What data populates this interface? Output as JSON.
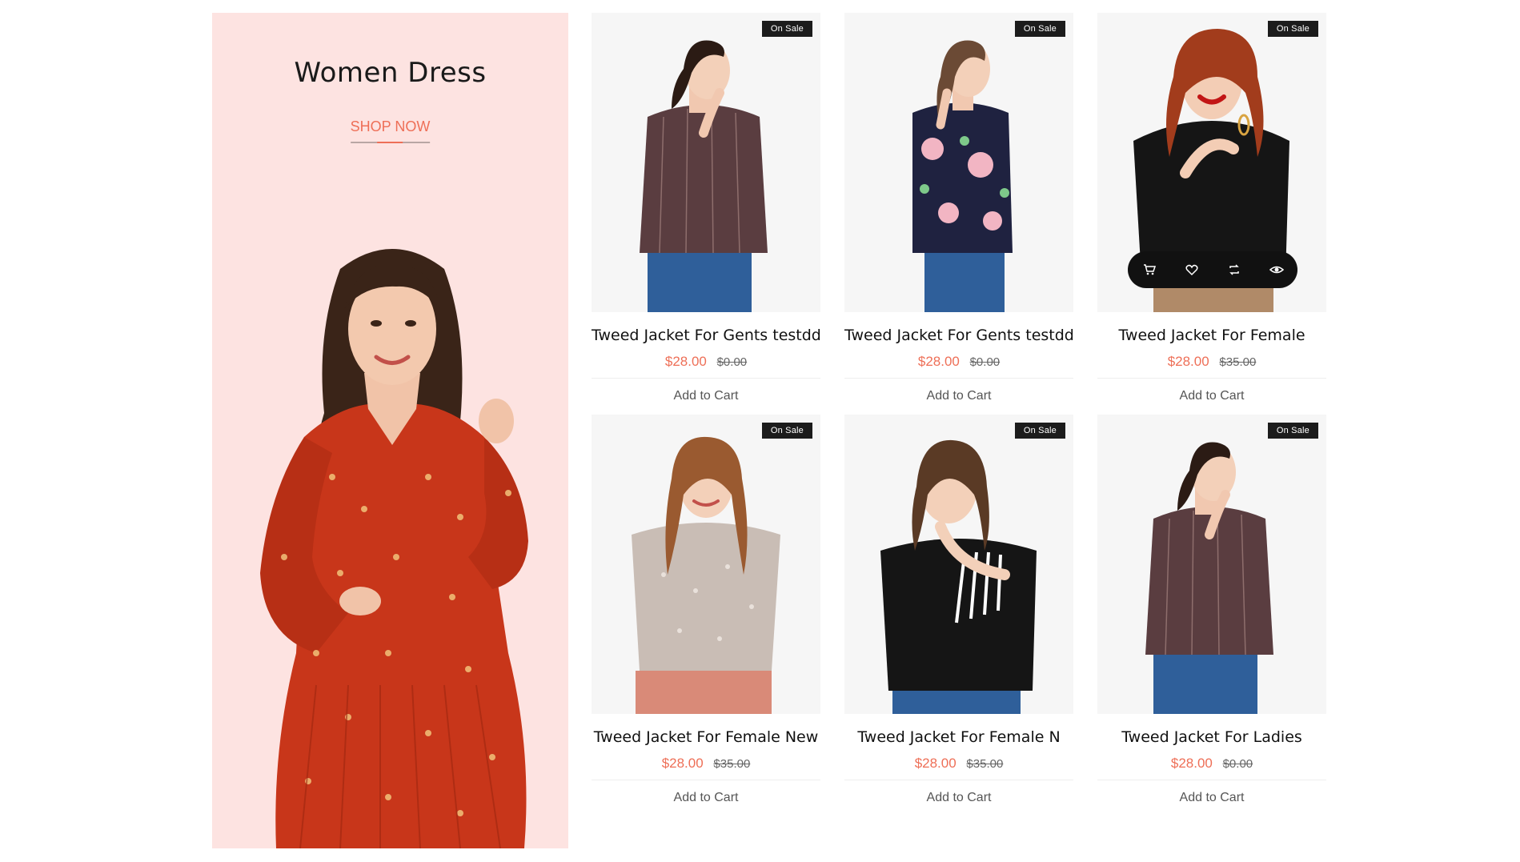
{
  "banner": {
    "title": "Women Dress",
    "cta_label": "SHOP NOW",
    "background_color": "#fde3e1",
    "accent_color": "#ee6f57"
  },
  "products": [
    {
      "title": "Tweed Jacket For Gents testdd",
      "price": "$28.00",
      "old_price": "$0.00",
      "badge": "On Sale",
      "cart_label": "Add to Cart",
      "image": "woman-striped-shirt"
    },
    {
      "title": "Tweed Jacket For Gents testdd",
      "price": "$28.00",
      "old_price": "$0.00",
      "badge": "On Sale",
      "cart_label": "Add to Cart",
      "image": "woman-floral-blouse"
    },
    {
      "title": "Tweed Jacket For Female",
      "price": "$28.00",
      "old_price": "$35.00",
      "badge": "On Sale",
      "cart_label": "Add to Cart",
      "image": "woman-black-sweater-red-hair"
    },
    {
      "title": "Tweed Jacket For Female New",
      "price": "$28.00",
      "old_price": "$35.00",
      "badge": "On Sale",
      "cart_label": "Add to Cart",
      "image": "woman-sequin-top"
    },
    {
      "title": "Tweed Jacket For Female N",
      "price": "$28.00",
      "old_price": "$35.00",
      "badge": "On Sale",
      "cart_label": "Add to Cart",
      "image": "woman-black-striped-top"
    },
    {
      "title": "Tweed Jacket For Ladies",
      "price": "$28.00",
      "old_price": "$0.00",
      "badge": "On Sale",
      "cart_label": "Add to Cart",
      "image": "woman-striped-shirt"
    }
  ],
  "hover_actions": [
    "cart-icon",
    "heart-icon",
    "compare-icon",
    "eye-icon"
  ]
}
